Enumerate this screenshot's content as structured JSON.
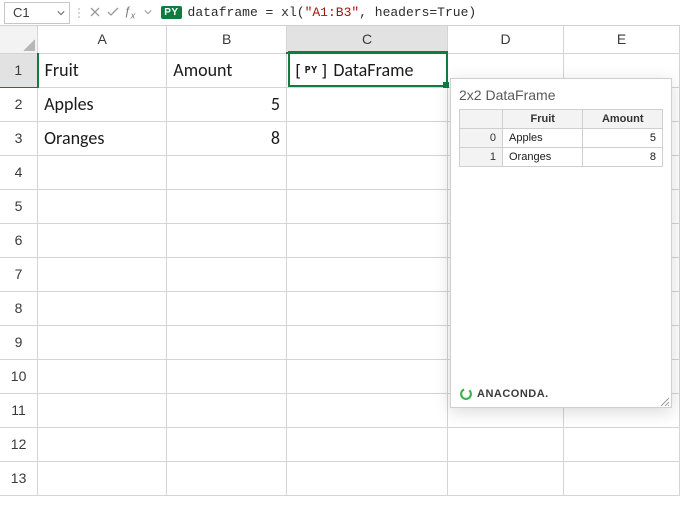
{
  "formula_bar": {
    "namebox": "C1",
    "py_badge": "PY",
    "formula_prefix": "dataframe = xl(",
    "formula_string": "\"A1:B3\"",
    "formula_suffix": ", headers=True)"
  },
  "columns": [
    "A",
    "B",
    "C",
    "D",
    "E"
  ],
  "rows": [
    "1",
    "2",
    "3",
    "4",
    "5",
    "6",
    "7",
    "8",
    "9",
    "10",
    "11",
    "12",
    "13"
  ],
  "cells": {
    "A1": "Fruit",
    "B1": "Amount",
    "A2": "Apples",
    "B2": "5",
    "A3": "Oranges",
    "B3": "8",
    "C1_py_label": "DataFrame",
    "C1_py_mini": "PY"
  },
  "selection": {
    "cell": "C1"
  },
  "preview": {
    "title": "2x2 DataFrame",
    "columns": [
      "Fruit",
      "Amount"
    ],
    "rows": [
      {
        "index": "0",
        "fruit": "Apples",
        "amount": "5"
      },
      {
        "index": "1",
        "fruit": "Oranges",
        "amount": "8"
      }
    ],
    "footer": "ANACONDA."
  },
  "chart_data": {
    "type": "table",
    "title": "2x2 DataFrame",
    "columns": [
      "Fruit",
      "Amount"
    ],
    "index": [
      0,
      1
    ],
    "data": [
      [
        "Apples",
        5
      ],
      [
        "Oranges",
        8
      ]
    ]
  }
}
